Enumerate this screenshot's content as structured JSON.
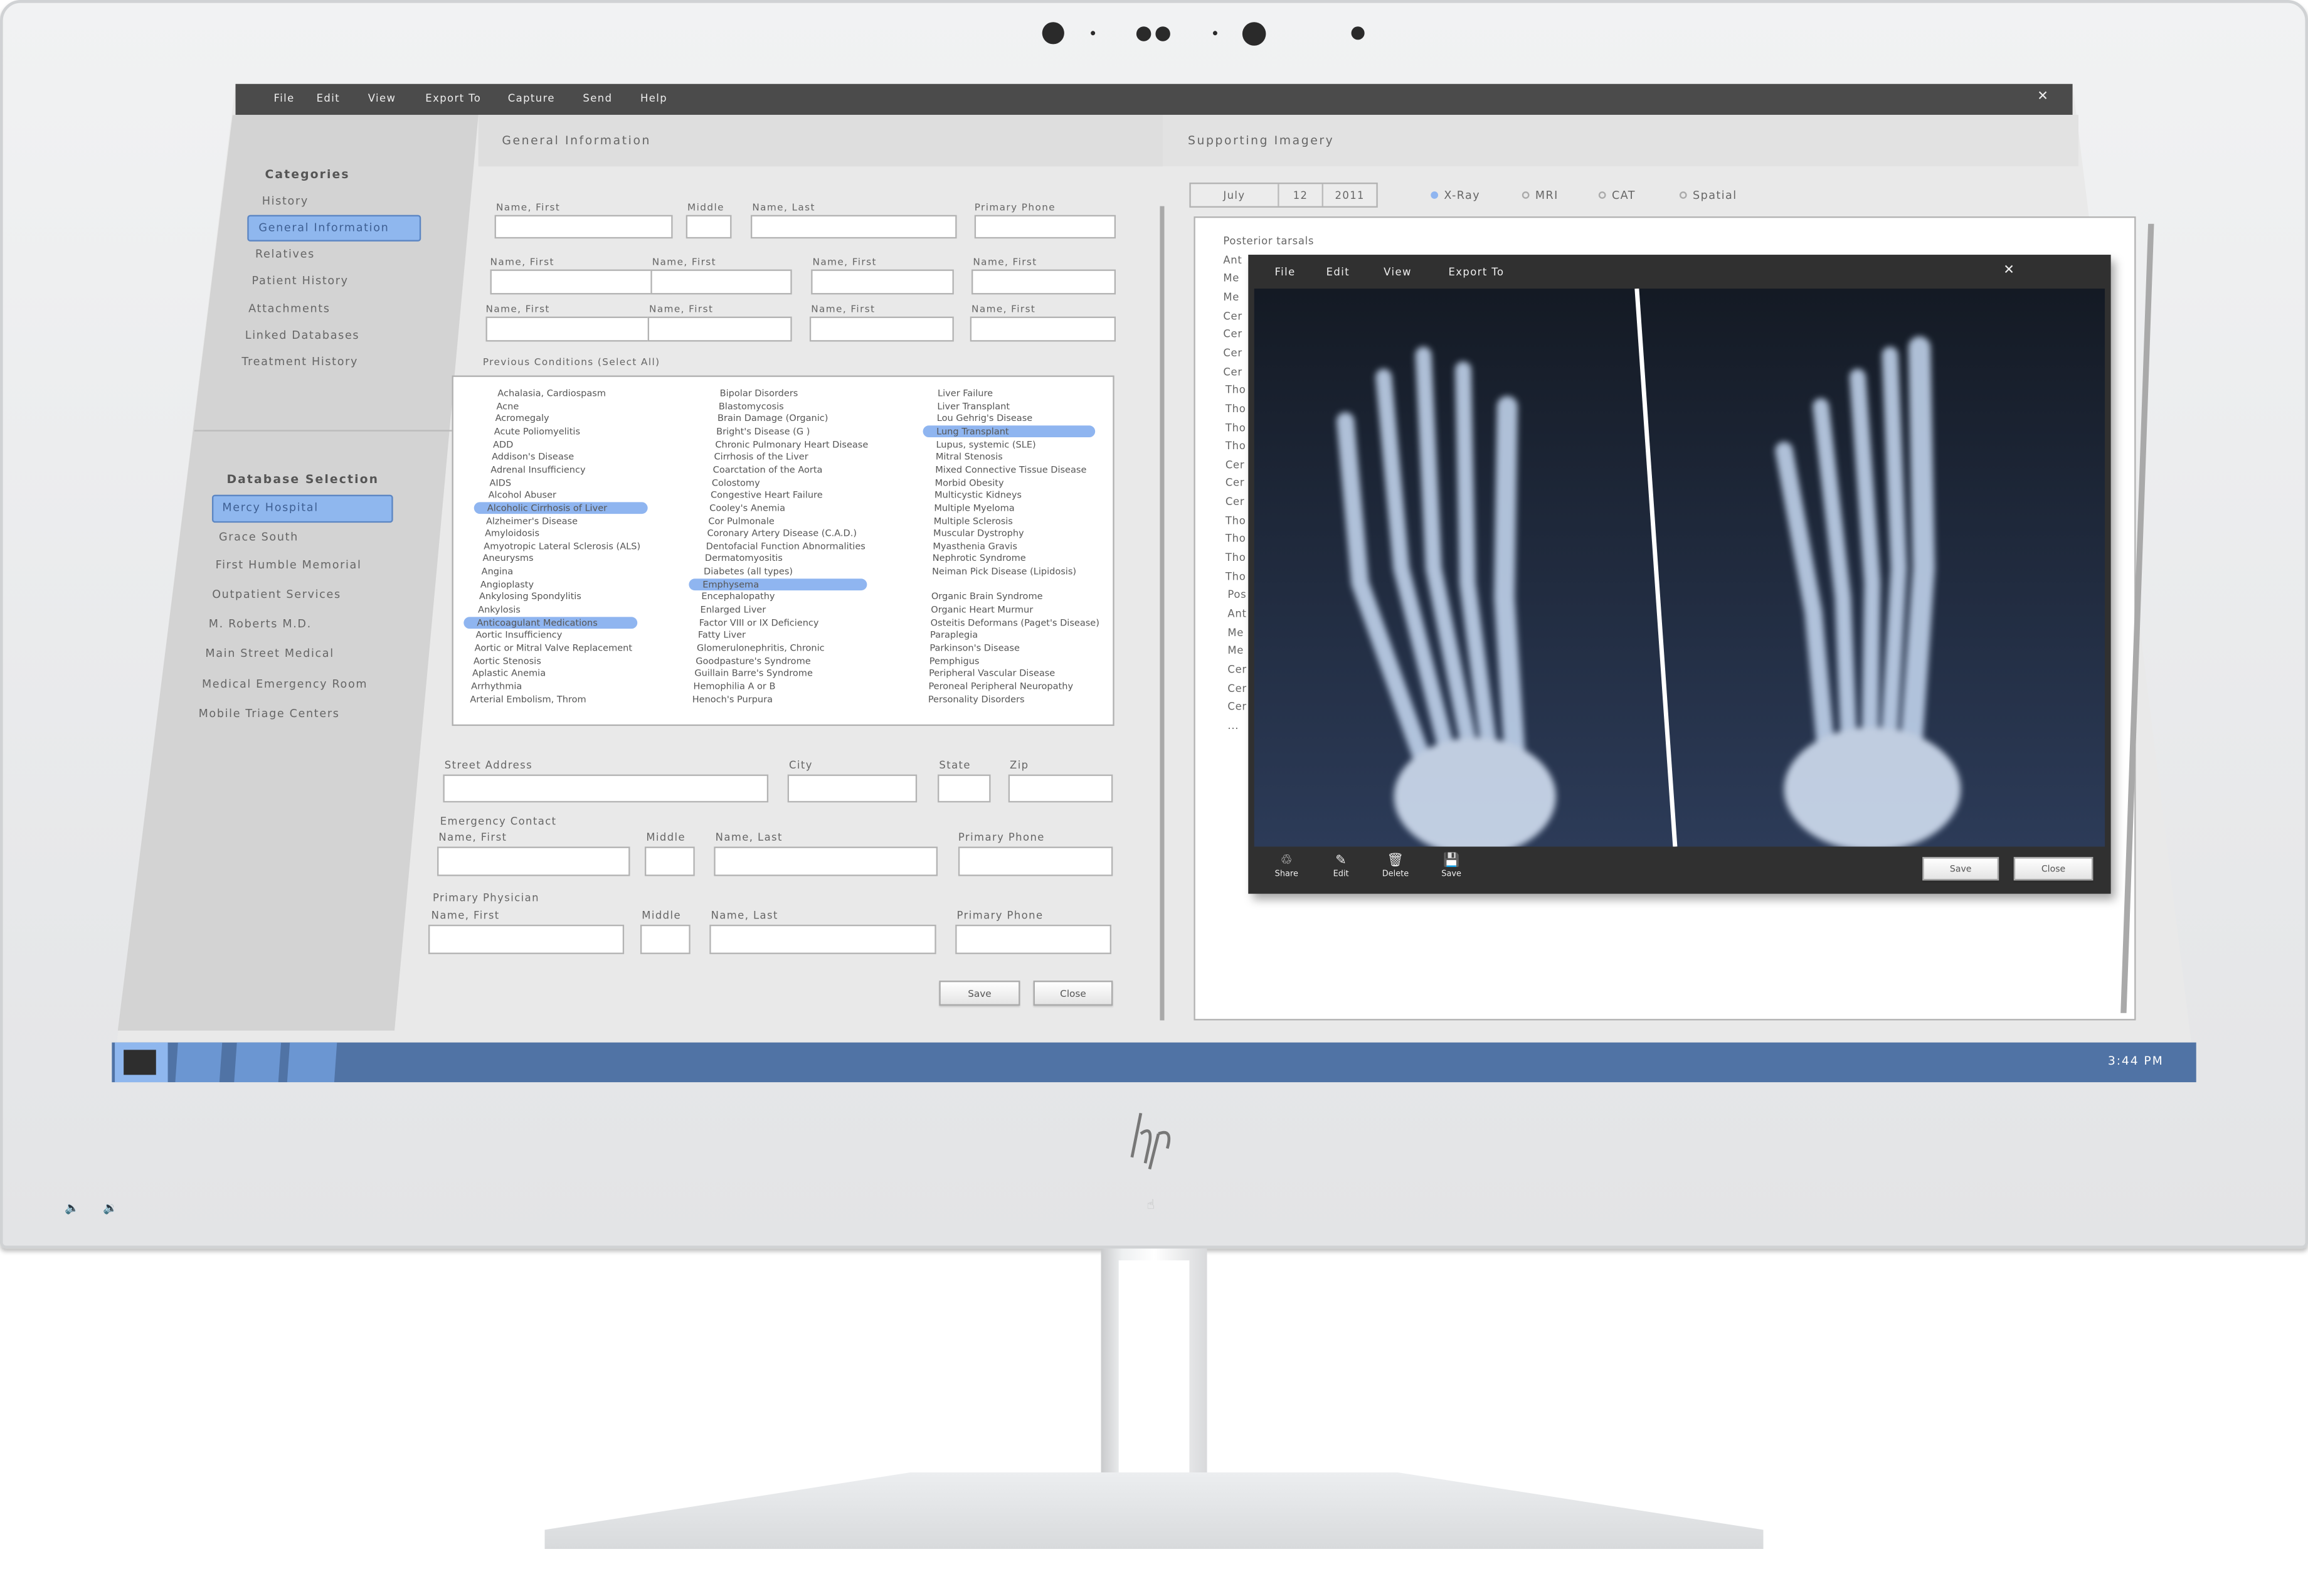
{
  "menubar": {
    "items": [
      "File",
      "Edit",
      "View",
      "Export To",
      "Capture",
      "Send",
      "Help"
    ],
    "close_icon": "close-icon"
  },
  "sidebar": {
    "categories_title": "Categories",
    "categories": [
      "History",
      "General Information",
      "Relatives",
      "Patient History",
      "Attachments",
      "Linked Databases",
      "Treatment History"
    ],
    "selected_category": "General Information",
    "database_title": "Database Selection",
    "databases": [
      "Mercy Hospital",
      "Grace South",
      "First Humble Memorial",
      "Outpatient Services",
      "M. Roberts M.D.",
      "Main Street Medical",
      "Medical Emergency Room",
      "Mobile Triage Centers"
    ],
    "selected_database": "Mercy Hospital"
  },
  "general": {
    "title": "General Information",
    "fields": [
      "Name, First",
      "Middle",
      "Name, Last",
      "Primary Phone",
      "Name, First",
      "Name, First",
      "Name, First",
      "Name, First",
      "Name, First",
      "Name, First",
      "Name, First",
      "Name, First",
      "Street Address",
      "City",
      "State",
      "Zip",
      "Name, First",
      "Middle",
      "Name, Last",
      "Primary Phone",
      "Name, First",
      "Middle",
      "Name, Last",
      "Primary Phone"
    ],
    "previous_conditions_label": "Previous Conditions (Select All)",
    "emergency_contact_label": "Emergency Contact",
    "primary_physician_label": "Primary Physician",
    "save_label": "Save",
    "close_label": "Close",
    "conditions": [
      [
        "Achalasia, Cardiospasm",
        "Acne",
        "Acromegaly",
        "Acute Poliomyelitis",
        "ADD",
        "Addison's Disease",
        "Adrenal Insufficiency",
        "AIDS",
        "Alcohol Abuser",
        "Alcoholic Cirrhosis of Liver",
        "Alzheimer's Disease",
        "Amyloidosis",
        "Amyotropic Lateral Sclerosis (ALS)",
        "Aneurysms",
        "Angina",
        "Angioplasty",
        "Ankylosing Spondylitis",
        "Ankylosis",
        "Anticoagulant Medications",
        "Aortic Insufficiency",
        "Aortic or Mitral Valve Replacement",
        "Aortic Stenosis",
        "Aplastic Anemia",
        "Arrhythmia",
        "Arterial Embolism, Throm"
      ],
      [
        "Bipolar Disorders",
        "Blastomycosis",
        "Brain Damage (Organic)",
        "Bright's Disease (G )",
        "Chronic Pulmonary Heart Disease",
        "Cirrhosis of the Liver",
        "Coarctation of the Aorta",
        "Colostomy",
        "Congestive Heart Failure",
        "Cooley's Anemia",
        "Cor Pulmonale",
        "Coronary Artery Disease (C.A.D.)",
        "Dentofacial Function Abnormalities",
        "Dermatomyositis",
        "Diabetes (all types)",
        "Emphysema",
        "Encephalopathy",
        "Enlarged Liver",
        "Factor VIII or IX Deficiency",
        "Fatty Liver",
        "Glomerulonephritis, Chronic",
        "Goodpasture's Syndrome",
        "Guillain Barre's Syndrome",
        "Hemophilia A or B",
        "Henoch's Purpura"
      ],
      [
        "Liver Failure",
        "Liver Transplant",
        "Lou Gehrig's Disease",
        "Lung Transplant",
        "Lupus, systemic (SLE)",
        "Mitral Stenosis",
        "Mixed Connective Tissue Disease",
        "Morbid Obesity",
        "Multicystic Kidneys",
        "Multiple Myeloma",
        "Multiple Sclerosis",
        "Muscular Dystrophy",
        "Myasthenia Gravis",
        "Nephrotic Syndrome",
        "Neiman Pick Disease (Lipidosis)",
        "",
        "Organic Brain Syndrome",
        "Organic Heart Murmur",
        "Osteitis Deformans (Paget's Disease)",
        "Paraplegia",
        "Parkinson's Disease",
        "Pemphigus",
        "Peripheral Vascular Disease",
        "Peroneal Peripheral Neuropathy",
        "Personality Disorders"
      ]
    ],
    "selected_conditions": [
      "Alcoholic Cirrhosis of Liver",
      "Anticoagulant Medications",
      "Emphysema",
      "Lung Transplant"
    ]
  },
  "imagery": {
    "title": "Supporting Imagery",
    "date": {
      "month": "July",
      "day": "12",
      "year": "2011"
    },
    "modalities": [
      "X-Ray",
      "MRI",
      "CAT",
      "Spatial"
    ],
    "selected_modality": "X-Ray",
    "items": [
      "Posterior tarsals",
      "Ant",
      "Me",
      "Me",
      "Cer",
      "Cer",
      "Cer",
      "Cer",
      "Tho",
      "Tho",
      "Tho",
      "Tho",
      "Cer",
      "Cer",
      "Cer",
      "Tho",
      "Tho",
      "Tho",
      "Tho",
      "Pos",
      "Ant",
      "Me",
      "Me",
      "Cer",
      "Cer",
      "Cer",
      "..."
    ]
  },
  "viewer": {
    "menu": [
      "File",
      "Edit",
      "View",
      "Export To"
    ],
    "tools": [
      {
        "label": "Share",
        "icon": "share-icon"
      },
      {
        "label": "Edit",
        "icon": "pencil-icon"
      },
      {
        "label": "Delete",
        "icon": "trash-icon"
      },
      {
        "label": "Save",
        "icon": "floppy-icon"
      }
    ],
    "save_label": "Save",
    "close_label": "Close"
  },
  "taskbar": {
    "time": "3:44 PM",
    "color": "#5073a5",
    "accent": "#8fb7ee"
  },
  "brand": {
    "logo": "hp"
  }
}
